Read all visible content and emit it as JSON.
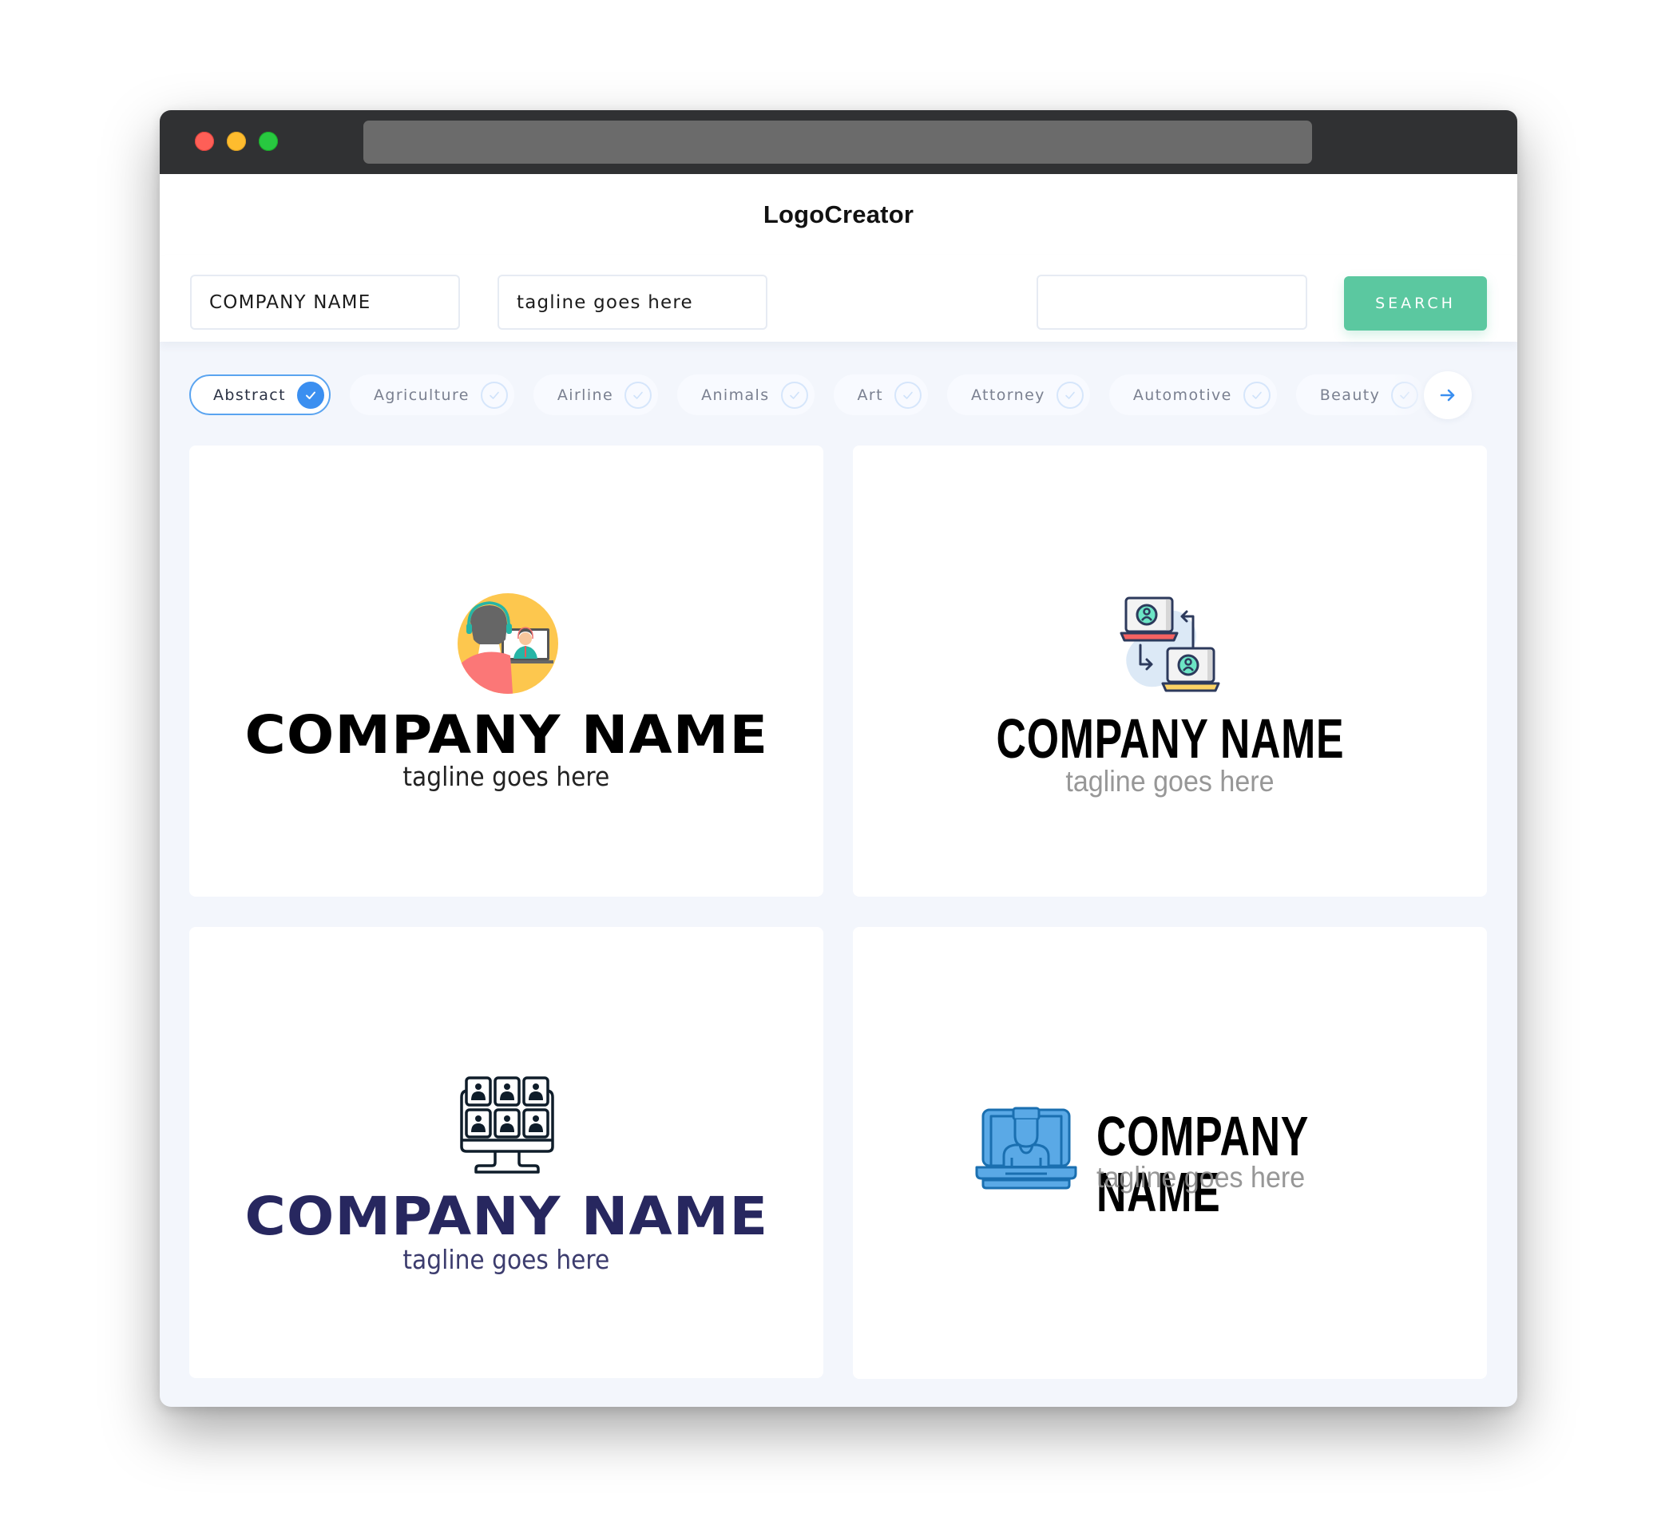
{
  "window": {
    "controls": [
      "close",
      "minimize",
      "maximize"
    ],
    "url": ""
  },
  "app": {
    "title": "LogoCreator"
  },
  "form": {
    "company_name_value": "COMPANY NAME",
    "tagline_value": "tagline goes here",
    "extra_field_value": "",
    "search_label": "SEARCH"
  },
  "categories": {
    "items": [
      {
        "label": "Abstract",
        "selected": true
      },
      {
        "label": "Agriculture",
        "selected": false
      },
      {
        "label": "Airline",
        "selected": false
      },
      {
        "label": "Animals",
        "selected": false
      },
      {
        "label": "Art",
        "selected": false
      },
      {
        "label": "Attorney",
        "selected": false
      },
      {
        "label": "Automotive",
        "selected": false
      },
      {
        "label": "Beauty",
        "selected": false
      }
    ],
    "next_icon": "arrow-right-icon"
  },
  "logos": [
    {
      "company": "COMPANY NAME",
      "tagline": "tagline goes here",
      "icon": "video-call-support-icon",
      "name_color": "#000000",
      "tagline_color": "#222222"
    },
    {
      "company": "COMPANY NAME",
      "tagline": "tagline goes here",
      "icon": "laptop-user-transfer-icon",
      "name_color": "#000000",
      "tagline_color": "#8c8c8c"
    },
    {
      "company": "COMPANY NAME",
      "tagline": "tagline goes here",
      "icon": "monitor-video-conference-icon",
      "name_color": "#27275f",
      "tagline_color": "#3c3c6e"
    },
    {
      "company": "COMPANY NAME",
      "tagline": "tagline goes here",
      "icon": "laptop-person-icon",
      "name_color": "#000000",
      "tagline_color": "#8c8c8c"
    }
  ],
  "colors": {
    "accent_green": "#5bc8a0",
    "accent_blue": "#3b8ff0",
    "titlebar": "#303133",
    "content_bg": "#f3f6fc"
  }
}
